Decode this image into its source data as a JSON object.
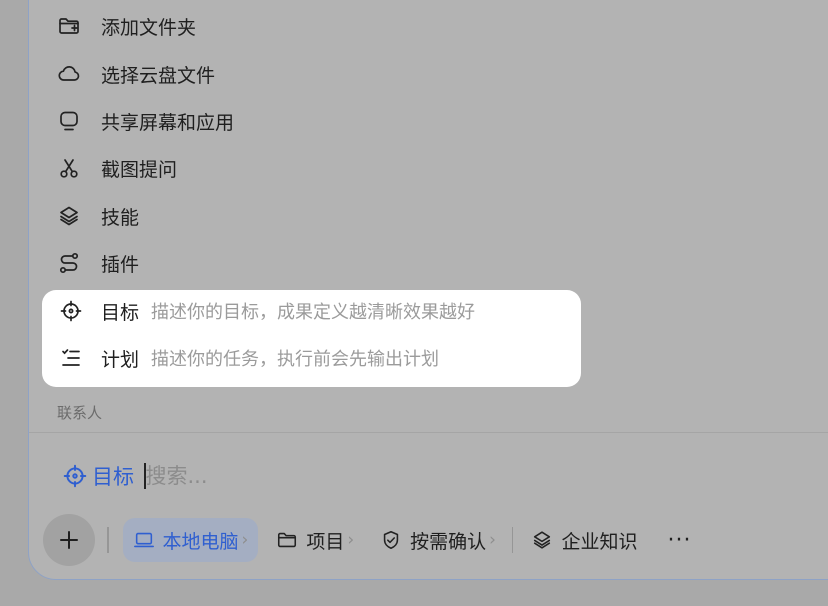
{
  "menu": {
    "items": [
      {
        "label": "添加文件夹",
        "icon": "folder-add-icon"
      },
      {
        "label": "选择云盘文件",
        "icon": "cloud-icon"
      },
      {
        "label": "共享屏幕和应用",
        "icon": "screen-share-icon"
      },
      {
        "label": "截图提问",
        "icon": "scissors-icon"
      },
      {
        "label": "技能",
        "icon": "layers-icon"
      },
      {
        "label": "插件",
        "icon": "plugin-icon"
      }
    ],
    "highlighted": [
      {
        "label": "目标",
        "hint": "描述你的目标，成果定义越清晰效果越好",
        "icon": "target-icon"
      },
      {
        "label": "计划",
        "hint": "描述你的任务，执行前会先输出计划",
        "icon": "plan-list-icon"
      }
    ],
    "section_label": "联系人"
  },
  "composer": {
    "goal_chip": "目标",
    "placeholder": "搜索..."
  },
  "toolbar": {
    "local_pc": "本地电脑",
    "project": "项目",
    "confirm": "按需确认",
    "knowledge": "企业知识",
    "more": "···",
    "chevron": "›"
  },
  "colors": {
    "accent": "#2f5fd0",
    "overlay": "#b3b3b3",
    "card": "#ffffff"
  }
}
